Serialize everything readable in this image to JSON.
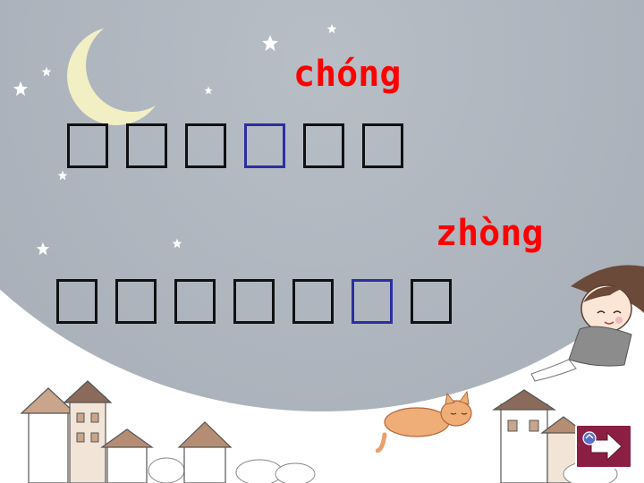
{
  "lines": [
    {
      "pinyin": "chóng",
      "boxes": [
        {
          "char": "□",
          "highlight": false
        },
        {
          "char": "□",
          "highlight": false
        },
        {
          "char": "□",
          "highlight": false
        },
        {
          "char": "□",
          "highlight": true
        },
        {
          "char": "□",
          "highlight": false
        },
        {
          "char": "□",
          "highlight": false
        }
      ]
    },
    {
      "pinyin": "zhòng",
      "boxes": [
        {
          "char": "□",
          "highlight": false
        },
        {
          "char": "□",
          "highlight": false
        },
        {
          "char": "□",
          "highlight": false
        },
        {
          "char": "□",
          "highlight": false
        },
        {
          "char": "□",
          "highlight": false
        },
        {
          "char": "□",
          "highlight": true
        },
        {
          "char": "□",
          "highlight": false
        }
      ]
    }
  ],
  "colors": {
    "pinyin": "#ff0000",
    "box_border": "#111111",
    "box_highlight": "#2b2fa0",
    "sky": "#aab1ba",
    "next_button": "#8a1f43"
  },
  "icons": {
    "next_button": "arrow-right-icon"
  }
}
